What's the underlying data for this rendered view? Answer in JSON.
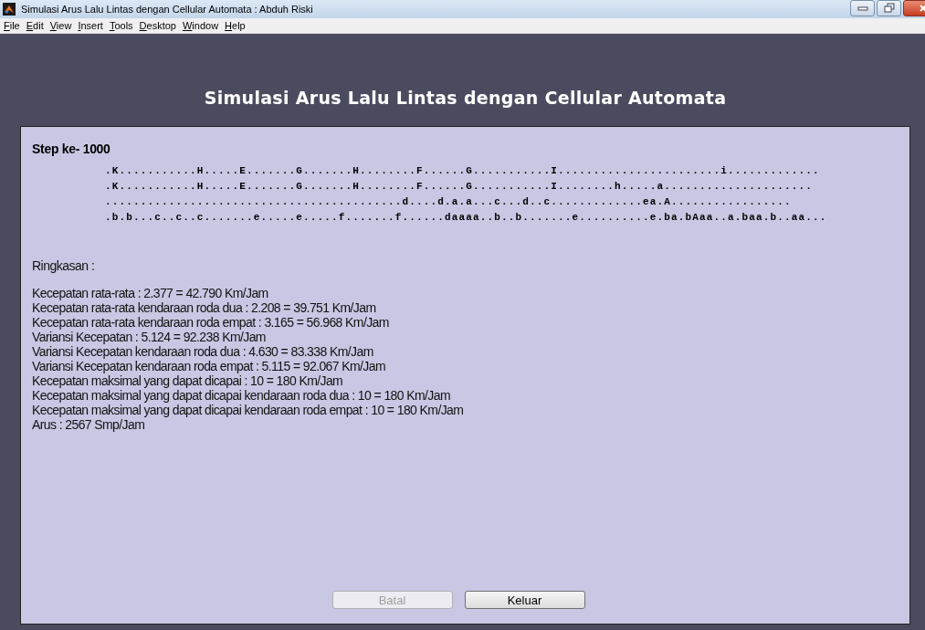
{
  "window": {
    "title": "Simulasi Arus Lalu Lintas dengan Cellular Automata : Abduh Riski"
  },
  "menu": [
    "File",
    "Edit",
    "View",
    "Insert",
    "Tools",
    "Desktop",
    "Window",
    "Help"
  ],
  "heading": "Simulasi Arus Lalu Lintas dengan Cellular Automata",
  "step": "Step ke- 1000",
  "lanes": [
    ".K...........H.....E.......G.......H........F......G...........I.......................i.............",
    ".K...........H.....E.......G.......H........F......G...........I........h.....a.....................",
    "..........................................d....d.a.a...c...d..c.............ea.A.................",
    ".b.b...c..c..c.......e.....e.....f.......f......daaaa..b..b.......e..........e.ba.bAaa..a.baa.b..aa..."
  ],
  "summary_title": "Ringkasan :",
  "summary": [
    "Kecepatan rata-rata : 2.377 = 42.790 Km/Jam",
    "Kecepatan rata-rata kendaraan roda dua : 2.208 = 39.751 Km/Jam",
    "Kecepatan rata-rata kendaraan roda empat : 3.165 = 56.968 Km/Jam",
    "Variansi Kecepatan : 5.124 = 92.238 Km/Jam",
    "Variansi Kecepatan kendaraan roda dua : 4.630 = 83.338 Km/Jam",
    "Variansi Kecepatan kendaraan roda empat : 5.115 = 92.067 Km/Jam",
    "Kecepatan maksimal yang dapat dicapai : 10 = 180 Km/Jam",
    "Kecepatan maksimal yang dapat dicapai kendaraan roda dua : 10 = 180 Km/Jam",
    "Kecepatan maksimal yang dapat dicapai kendaraan roda empat : 10 = 180 Km/Jam",
    "Arus : 2567 Smp/Jam"
  ],
  "buttons": [
    {
      "label": "Batal",
      "disabled": true
    },
    {
      "label": "Keluar",
      "disabled": false
    }
  ]
}
